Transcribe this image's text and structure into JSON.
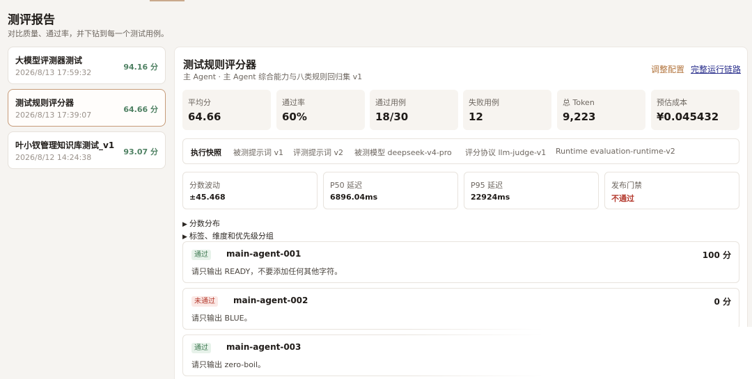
{
  "page": {
    "title": "测评报告",
    "subtitle": "对比质量、通过率，并下钻到每一个测试用例。"
  },
  "runs": [
    {
      "name": "大模型评测器测试",
      "time": "2026/8/13 17:59:32",
      "score": "94.16 分"
    },
    {
      "name": "测试规则评分器",
      "time": "2026/8/13 17:39:07",
      "score": "64.66 分"
    },
    {
      "name": "叶小钗管理知识库测试_v1",
      "time": "2026/8/12 14:24:38",
      "score": "93.07 分"
    }
  ],
  "detail": {
    "title": "测试规则评分器",
    "subtitle": "主 Agent · 主 Agent 综合能力与八类规则回归集 v1",
    "adjust_label": "调整配置",
    "chain_label": "完整运行链路",
    "stats": [
      {
        "label": "平均分",
        "value": "64.66"
      },
      {
        "label": "通过率",
        "value": "60%"
      },
      {
        "label": "通过用例",
        "value": "18/30"
      },
      {
        "label": "失败用例",
        "value": "12"
      },
      {
        "label": "总 Token",
        "value": "9,223"
      },
      {
        "label": "预估成本",
        "value": "¥0.045432"
      }
    ],
    "snapshot": {
      "title": "执行快照",
      "items": [
        "被测提示词 v1",
        "评测提示词 v2",
        "被测模型 deepseek-v4-pro",
        "评分协议 llm-judge-v1",
        "Runtime evaluation-runtime-v2"
      ]
    },
    "metrics": [
      {
        "label": "分数波动",
        "value": "±45.468"
      },
      {
        "label": "P50 延迟",
        "value": "6896.04ms"
      },
      {
        "label": "P95 延迟",
        "value": "22924ms"
      },
      {
        "label": "发布门禁",
        "value": "不通过"
      }
    ],
    "collapsibles": [
      "分数分布",
      "标签、维度和优先级分组"
    ],
    "cases": [
      {
        "status": "通过",
        "id": "main-agent-001",
        "score": "100 分",
        "prompt": "请只输出 READY，不要添加任何其他字符。"
      },
      {
        "status": "未通过",
        "id": "main-agent-002",
        "score": "0 分",
        "prompt": "请只输出 BLUE。"
      },
      {
        "status": "通过",
        "id": "main-agent-003",
        "score": "",
        "prompt": "请只输出 zero-boil。"
      }
    ]
  },
  "colors": {
    "accent": "#b3763f",
    "pass": "#3f7a52",
    "fail": "#b43a2e",
    "active_border": "#c69b79"
  }
}
